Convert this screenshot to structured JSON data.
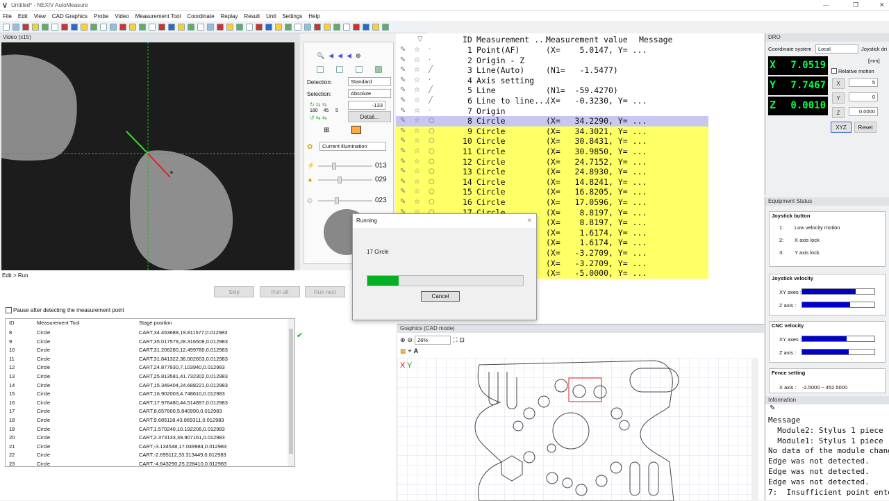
{
  "window": {
    "title": "Untitled* - NEXIV AutoMeasure"
  },
  "menu": [
    "File",
    "Edit",
    "View",
    "CAD Graphics",
    "Probe",
    "Video",
    "Measurement Tool",
    "Coordinate",
    "Replay",
    "Result",
    "Unit",
    "Settings",
    "Help"
  ],
  "video": {
    "title": "Video (x15)"
  },
  "controls": {
    "detection_label": "Detection:",
    "detection_value": "Standard",
    "selection_label": "Selection:",
    "selection_value": "Absolute",
    "rot1": "180",
    "rot2": "45",
    "rot3": "5",
    "angle_value": "-133",
    "detail_button": "Detail...",
    "illumination_value": "Current illumination",
    "light1": "013",
    "light2": "029",
    "light3": "023"
  },
  "run": {
    "breadcrumb": "Edit > Run",
    "skip": "Skip",
    "run_all": "Run all",
    "run_next": "Run next",
    "pause_label": "Pause after detecting the measurement point",
    "columns": [
      "ID",
      "Measurement Tool",
      "Stage position"
    ],
    "rows": [
      {
        "id": "8",
        "tool": "Circle",
        "pos": "CART,34.453688,19.811577,0.012983"
      },
      {
        "id": "9",
        "tool": "Circle",
        "pos": "CART,35.017579,28.316508,0.012983"
      },
      {
        "id": "10",
        "tool": "Circle",
        "pos": "CART,31.206280,12.499780,0.012983"
      },
      {
        "id": "11",
        "tool": "Circle",
        "pos": "CART,31.841322,36.002603,0.012983"
      },
      {
        "id": "12",
        "tool": "Circle",
        "pos": "CART,24.877930,7.103940,0.012983"
      },
      {
        "id": "13",
        "tool": "Circle",
        "pos": "CART,25.813581,41.732302,0.012983"
      },
      {
        "id": "14",
        "tool": "Circle",
        "pos": "CART,15.349404,24.688221,0.012983"
      },
      {
        "id": "15",
        "tool": "Circle",
        "pos": "CART,16.902003,4.748610,0.012983"
      },
      {
        "id": "16",
        "tool": "Circle",
        "pos": "CART,17.976480,44.514897,0.012983"
      },
      {
        "id": "17",
        "tool": "Circle",
        "pos": "CART,8.657600,5.840990,0.012983"
      },
      {
        "id": "18",
        "tool": "Circle",
        "pos": "CART,9.685118,43.869311,0.012983"
      },
      {
        "id": "19",
        "tool": "Circle",
        "pos": "CART,1.570240,10.192206,0.012983"
      },
      {
        "id": "20",
        "tool": "Circle",
        "pos": "CART,2.373133,39.907161,0.012983"
      },
      {
        "id": "21",
        "tool": "Circle",
        "pos": "CART,-3.134548,17.049984,0.012983"
      },
      {
        "id": "22",
        "tool": "Circle",
        "pos": "CART,-2.695112,33.313449,0.012983"
      },
      {
        "id": "23",
        "tool": "Circle",
        "pos": "CART,-4.643290,25.228410,0.012983"
      }
    ]
  },
  "measurements": {
    "headers": {
      "id": "ID",
      "tool": "Measurement ...",
      "value": "Measurement value",
      "message": "Message"
    },
    "rows": [
      {
        "id": "1",
        "tool": "Point(AF)",
        "value": "(X=    5.0147, Y= ...",
        "style": ""
      },
      {
        "id": "2",
        "tool": "Origin - Z",
        "value": "",
        "style": ""
      },
      {
        "id": "3",
        "tool": "Line(Auto)",
        "value": "(N1=   -1.5477)",
        "style": ""
      },
      {
        "id": "4",
        "tool": "Axis setting",
        "value": "",
        "style": ""
      },
      {
        "id": "5",
        "tool": "Line",
        "value": "(N1=  -59.4270)",
        "style": ""
      },
      {
        "id": "6",
        "tool": "Line to line...",
        "value": "(X=   -0.3230, Y= ...",
        "style": ""
      },
      {
        "id": "7",
        "tool": "Origin",
        "value": "",
        "style": ""
      },
      {
        "id": "8",
        "tool": "Circle",
        "value": "(X=   34.2290, Y= ...",
        "style": "cur"
      },
      {
        "id": "9",
        "tool": "Circle",
        "value": "(X=   34.3021, Y= ...",
        "style": "hl"
      },
      {
        "id": "10",
        "tool": "Circle",
        "value": "(X=   30.8431, Y= ...",
        "style": "hl"
      },
      {
        "id": "11",
        "tool": "Circle",
        "value": "(X=   30.9850, Y= ...",
        "style": "hl"
      },
      {
        "id": "12",
        "tool": "Circle",
        "value": "(X=   24.7152, Y= ...",
        "style": "hl"
      },
      {
        "id": "13",
        "tool": "Circle",
        "value": "(X=   24.8930, Y= ...",
        "style": "hl"
      },
      {
        "id": "14",
        "tool": "Circle",
        "value": "(X=   14.8241, Y= ...",
        "style": "hl"
      },
      {
        "id": "15",
        "tool": "Circle",
        "value": "(X=   16.8205, Y= ...",
        "style": "hl"
      },
      {
        "id": "16",
        "tool": "Circle",
        "value": "(X=   17.0596, Y= ...",
        "style": "hl"
      },
      {
        "id": "17",
        "tool": "Circle",
        "value": "(X=    8.8197, Y= ...",
        "style": "hl"
      },
      {
        "id": "18",
        "tool": "Circle",
        "value": "(X=    8.8197, Y= ...",
        "style": "hl"
      },
      {
        "id": "19",
        "tool": "Circle",
        "value": "(X=    1.6174, Y= ...",
        "style": "hl"
      },
      {
        "id": "20",
        "tool": "Circle",
        "value": "(X=    1.6174, Y= ...",
        "style": "hl"
      },
      {
        "id": "21",
        "tool": "Circle",
        "value": "(X=   -3.2709, Y= ...",
        "style": "hl"
      },
      {
        "id": "22",
        "tool": "Circle",
        "value": "(X=   -3.2709, Y= ...",
        "style": "hl"
      },
      {
        "id": "23",
        "tool": "Circle",
        "value": "(X=   -5.0000, Y= ...",
        "style": "hl"
      }
    ]
  },
  "dro": {
    "title": "DRO",
    "coord_label": "Coordinate system",
    "coord_value": "Local",
    "joystick_tab": "Joystick dri",
    "unit": "[mm]",
    "relative_label": "Relative motion",
    "x": "7.0519",
    "y": "7.7467",
    "z": "0.0010",
    "ax_x": "X",
    "ax_y": "Y",
    "ax_z": "Z",
    "in_x": "5",
    "in_y": "0",
    "in_z": "0.0000",
    "xyz_button": "XYZ",
    "reset_button": "Reset"
  },
  "equipment": {
    "title": "Equipment Status",
    "joystick_button": "Joystick button",
    "items": [
      {
        "num": "1:",
        "label": "Low velocity motion"
      },
      {
        "num": "2:",
        "label": "X axis lock"
      },
      {
        "num": "3:",
        "label": "Y axis lock"
      }
    ],
    "joystick_velocity": "Joystick velocity",
    "cnc_velocity": "CNC velocity",
    "xy_axes": "XY axes :",
    "z_axis": "Z axis :",
    "jv_xy": 0.74,
    "jv_z": 0.66,
    "cnc_xy": 0.62,
    "cnc_z": 0.64,
    "fence_setting": "Fence setting",
    "fence_x": "X axis :    -2.5000 ~ 452.5000"
  },
  "information": {
    "title": "Information",
    "lines": [
      "Message",
      "  Module2: Stylus 1 piece",
      "  Module1: Stylus 1 piece",
      "No data of the module chang",
      "Edge was not detected.",
      "Edge was not detected.",
      "Edge was not detected.",
      "7:  Insufficient point ente"
    ]
  },
  "graphics": {
    "title": "Graphics (CAD mode)",
    "zoom": "26%",
    "axis_x": "X",
    "axis_y": "Y"
  },
  "dialog": {
    "title": "Running",
    "message": "17 Circle",
    "progress": 0.2,
    "cancel": "Cancel"
  }
}
